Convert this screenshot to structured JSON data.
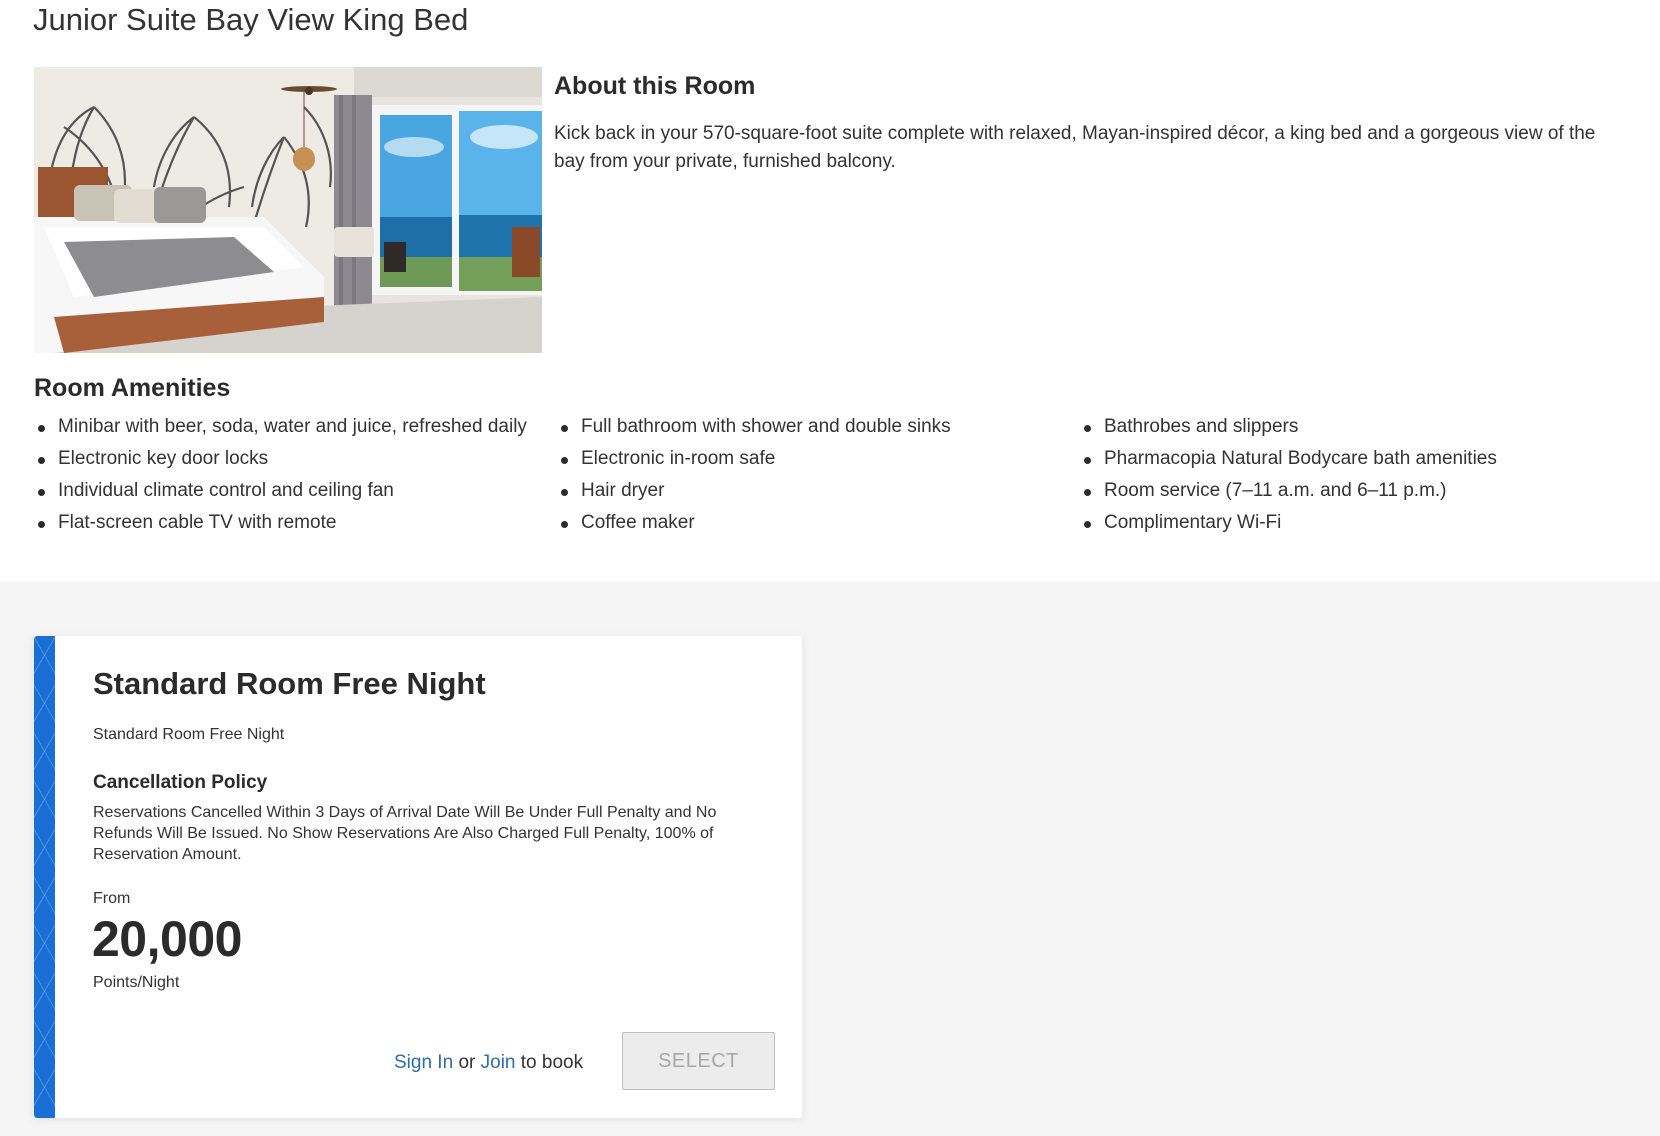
{
  "room": {
    "title": "Junior Suite Bay View King Bed",
    "photo_alt": "Junior suite bedroom with king bed and bay view balcony"
  },
  "about": {
    "heading": "About this Room",
    "text": "Kick back in your 570-square-foot suite complete with relaxed, Mayan-inspired décor, a king bed and a gorgeous view of the bay from your private, furnished balcony."
  },
  "amenities": {
    "heading": "Room Amenities",
    "columns": [
      [
        "Minibar with beer, soda, water and juice, refreshed daily",
        "Electronic key door locks",
        "Individual climate control and ceiling fan",
        "Flat-screen cable TV with remote"
      ],
      [
        "Full bathroom with shower and double sinks",
        "Electronic in-room safe",
        "Hair dryer",
        "Coffee maker"
      ],
      [
        "Bathrobes and slippers",
        "Pharmacopia Natural Bodycare bath amenities",
        "Room service (7–11 a.m. and 6–11 p.m.)",
        "Complimentary Wi-Fi"
      ]
    ]
  },
  "rate": {
    "name": "Standard Room Free Night",
    "description": "Standard Room Free Night",
    "policy_heading": "Cancellation Policy",
    "policy_text": "Reservations Cancelled Within 3 Days of Arrival Date Will Be Under Full Penalty and No Refunds Will Be Issued. No Show Reservations Are Also Charged Full Penalty, 100% of Reservation Amount.",
    "from_label": "From",
    "price": "20,000",
    "price_unit": "Points/Night",
    "sign_in_label": "Sign In",
    "or_label": "or",
    "join_label": "Join",
    "to_book_label": "to book",
    "select_label": "SELECT"
  },
  "colors": {
    "accent_stripe": "#1a6fd6",
    "link": "#2f6ea5",
    "rates_background": "#f5f5f5"
  }
}
